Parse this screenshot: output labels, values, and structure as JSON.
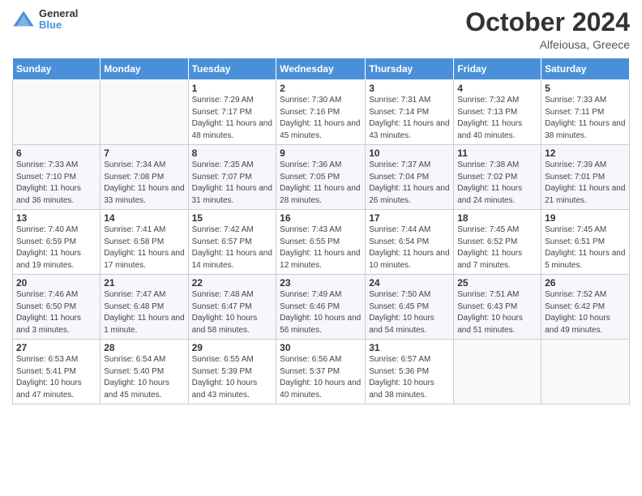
{
  "header": {
    "logo_line1": "General",
    "logo_line2": "Blue",
    "month_year": "October 2024",
    "location": "Alfeiousa, Greece"
  },
  "days_of_week": [
    "Sunday",
    "Monday",
    "Tuesday",
    "Wednesday",
    "Thursday",
    "Friday",
    "Saturday"
  ],
  "weeks": [
    [
      {
        "day": "",
        "info": ""
      },
      {
        "day": "",
        "info": ""
      },
      {
        "day": "1",
        "info": "Sunrise: 7:29 AM\nSunset: 7:17 PM\nDaylight: 11 hours and 48 minutes."
      },
      {
        "day": "2",
        "info": "Sunrise: 7:30 AM\nSunset: 7:16 PM\nDaylight: 11 hours and 45 minutes."
      },
      {
        "day": "3",
        "info": "Sunrise: 7:31 AM\nSunset: 7:14 PM\nDaylight: 11 hours and 43 minutes."
      },
      {
        "day": "4",
        "info": "Sunrise: 7:32 AM\nSunset: 7:13 PM\nDaylight: 11 hours and 40 minutes."
      },
      {
        "day": "5",
        "info": "Sunrise: 7:33 AM\nSunset: 7:11 PM\nDaylight: 11 hours and 38 minutes."
      }
    ],
    [
      {
        "day": "6",
        "info": "Sunrise: 7:33 AM\nSunset: 7:10 PM\nDaylight: 11 hours and 36 minutes."
      },
      {
        "day": "7",
        "info": "Sunrise: 7:34 AM\nSunset: 7:08 PM\nDaylight: 11 hours and 33 minutes."
      },
      {
        "day": "8",
        "info": "Sunrise: 7:35 AM\nSunset: 7:07 PM\nDaylight: 11 hours and 31 minutes."
      },
      {
        "day": "9",
        "info": "Sunrise: 7:36 AM\nSunset: 7:05 PM\nDaylight: 11 hours and 28 minutes."
      },
      {
        "day": "10",
        "info": "Sunrise: 7:37 AM\nSunset: 7:04 PM\nDaylight: 11 hours and 26 minutes."
      },
      {
        "day": "11",
        "info": "Sunrise: 7:38 AM\nSunset: 7:02 PM\nDaylight: 11 hours and 24 minutes."
      },
      {
        "day": "12",
        "info": "Sunrise: 7:39 AM\nSunset: 7:01 PM\nDaylight: 11 hours and 21 minutes."
      }
    ],
    [
      {
        "day": "13",
        "info": "Sunrise: 7:40 AM\nSunset: 6:59 PM\nDaylight: 11 hours and 19 minutes."
      },
      {
        "day": "14",
        "info": "Sunrise: 7:41 AM\nSunset: 6:58 PM\nDaylight: 11 hours and 17 minutes."
      },
      {
        "day": "15",
        "info": "Sunrise: 7:42 AM\nSunset: 6:57 PM\nDaylight: 11 hours and 14 minutes."
      },
      {
        "day": "16",
        "info": "Sunrise: 7:43 AM\nSunset: 6:55 PM\nDaylight: 11 hours and 12 minutes."
      },
      {
        "day": "17",
        "info": "Sunrise: 7:44 AM\nSunset: 6:54 PM\nDaylight: 11 hours and 10 minutes."
      },
      {
        "day": "18",
        "info": "Sunrise: 7:45 AM\nSunset: 6:52 PM\nDaylight: 11 hours and 7 minutes."
      },
      {
        "day": "19",
        "info": "Sunrise: 7:45 AM\nSunset: 6:51 PM\nDaylight: 11 hours and 5 minutes."
      }
    ],
    [
      {
        "day": "20",
        "info": "Sunrise: 7:46 AM\nSunset: 6:50 PM\nDaylight: 11 hours and 3 minutes."
      },
      {
        "day": "21",
        "info": "Sunrise: 7:47 AM\nSunset: 6:48 PM\nDaylight: 11 hours and 1 minute."
      },
      {
        "day": "22",
        "info": "Sunrise: 7:48 AM\nSunset: 6:47 PM\nDaylight: 10 hours and 58 minutes."
      },
      {
        "day": "23",
        "info": "Sunrise: 7:49 AM\nSunset: 6:46 PM\nDaylight: 10 hours and 56 minutes."
      },
      {
        "day": "24",
        "info": "Sunrise: 7:50 AM\nSunset: 6:45 PM\nDaylight: 10 hours and 54 minutes."
      },
      {
        "day": "25",
        "info": "Sunrise: 7:51 AM\nSunset: 6:43 PM\nDaylight: 10 hours and 51 minutes."
      },
      {
        "day": "26",
        "info": "Sunrise: 7:52 AM\nSunset: 6:42 PM\nDaylight: 10 hours and 49 minutes."
      }
    ],
    [
      {
        "day": "27",
        "info": "Sunrise: 6:53 AM\nSunset: 5:41 PM\nDaylight: 10 hours and 47 minutes."
      },
      {
        "day": "28",
        "info": "Sunrise: 6:54 AM\nSunset: 5:40 PM\nDaylight: 10 hours and 45 minutes."
      },
      {
        "day": "29",
        "info": "Sunrise: 6:55 AM\nSunset: 5:39 PM\nDaylight: 10 hours and 43 minutes."
      },
      {
        "day": "30",
        "info": "Sunrise: 6:56 AM\nSunset: 5:37 PM\nDaylight: 10 hours and 40 minutes."
      },
      {
        "day": "31",
        "info": "Sunrise: 6:57 AM\nSunset: 5:36 PM\nDaylight: 10 hours and 38 minutes."
      },
      {
        "day": "",
        "info": ""
      },
      {
        "day": "",
        "info": ""
      }
    ]
  ]
}
